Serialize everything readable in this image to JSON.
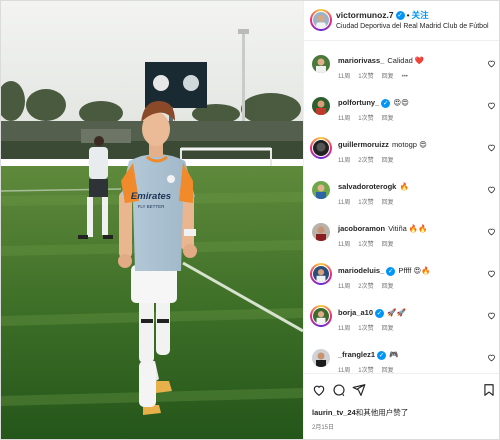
{
  "post": {
    "username": "victormunoz.7",
    "separator": "•",
    "follow_label": "关注",
    "location": "Ciudad Deportiva del Real Madrid Club de Fútbol",
    "kit": {
      "sponsor": "Emirates",
      "sponsor_sub": "FLY BETTER"
    }
  },
  "comments": [
    {
      "user": "mariorivass_",
      "text": "Calidad",
      "emoji": "❤️",
      "time": "11周",
      "likes": "1次赞",
      "reply": "回复",
      "more": "•••"
    },
    {
      "user": "polfortuny_",
      "verified": true,
      "text": "",
      "emoji": "😍😍",
      "time": "11周",
      "likes": "1次赞",
      "reply": "回复"
    },
    {
      "user": "guillermoruizz",
      "text": "motogp",
      "emoji": "😍",
      "time": "11周",
      "likes": "2次赞",
      "reply": "回复"
    },
    {
      "user": "salvadoroterogk",
      "text": "",
      "emoji": "🔥",
      "time": "11周",
      "likes": "1次赞",
      "reply": "回复"
    },
    {
      "user": "jacoboramon",
      "text": "Vitiña",
      "emoji": "🔥🔥",
      "time": "11周",
      "likes": "1次赞",
      "reply": "回复"
    },
    {
      "user": "mariodeluis_",
      "verified": true,
      "text": "Pffff",
      "emoji": "😍🔥",
      "time": "11周",
      "likes": "2次赞",
      "reply": "回复"
    },
    {
      "user": "borja_a10",
      "verified": true,
      "text": "",
      "emoji": "🚀🚀",
      "time": "11周",
      "likes": "1次赞",
      "reply": "回复"
    },
    {
      "user": "_franglez1",
      "verified": true,
      "text": "",
      "emoji": "🎮",
      "time": "11周",
      "likes": "1次赞",
      "reply": "回复"
    }
  ],
  "footer": {
    "liked_by_user": "laurin_tv_24",
    "liked_by_text": "和其他用户赞了",
    "date": "2月15日"
  },
  "colors": {
    "accent": "#0095f6",
    "meta": "#737373",
    "heart_outline": "#262626"
  }
}
